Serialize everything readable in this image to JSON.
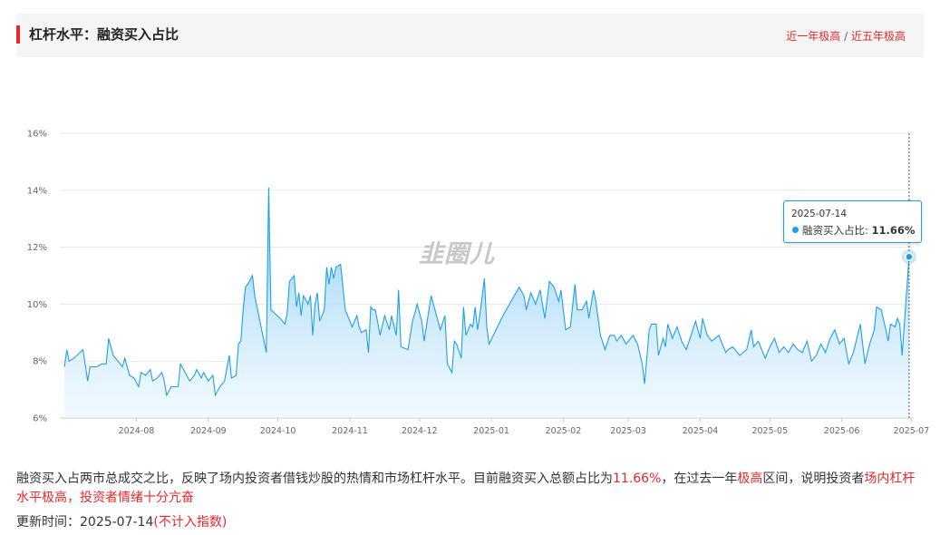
{
  "header": {
    "title": "杠杆水平：融资买入占比",
    "link_year": "近一年极高",
    "link_sep": "/",
    "link_five": "近五年极高"
  },
  "watermark": "韭圈儿",
  "tooltip": {
    "date": "2025-07-14",
    "label": "融资买入占比:",
    "value": "11.66%"
  },
  "description": {
    "p1": "融资买入占两市总成交之比，反映了场内投资者借钱炒股的热情和市场杠杆水平。目前融资买入总额占比为",
    "v1": "11.66%",
    "p2": "，在过去一年",
    "v2": "极高",
    "p3": "区间，说明投资者",
    "v3": "场内杠杆水平极高，投资者情绪十分亢奋"
  },
  "update": {
    "label": "更新时间：2025-07-14",
    "note": "(不计入指数)"
  },
  "colors": {
    "line": "#1ea0e8",
    "area_top": "#8fd0f5",
    "accent": "#e8282b"
  },
  "chart_data": {
    "type": "area",
    "series": [
      {
        "name": "融资买入占比",
        "points": [
          [
            "2024-07-15",
            7.8
          ],
          [
            "2024-07-16",
            8.4
          ],
          [
            "2024-07-17",
            8.0
          ],
          [
            "2024-07-19",
            8.1
          ],
          [
            "2024-07-23",
            8.4
          ],
          [
            "2024-07-25",
            7.3
          ],
          [
            "2024-07-26",
            7.8
          ],
          [
            "2024-07-29",
            7.8
          ],
          [
            "2024-07-31",
            7.9
          ],
          [
            "2024-08-02",
            7.9
          ],
          [
            "2024-08-03",
            8.8
          ],
          [
            "2024-08-05",
            8.2
          ],
          [
            "2024-08-07",
            8.0
          ],
          [
            "2024-08-09",
            7.8
          ],
          [
            "2024-08-10",
            8.1
          ],
          [
            "2024-08-12",
            7.5
          ],
          [
            "2024-08-14",
            7.4
          ],
          [
            "2024-08-16",
            7.1
          ],
          [
            "2024-08-17",
            7.6
          ],
          [
            "2024-08-19",
            7.5
          ],
          [
            "2024-08-21",
            7.7
          ],
          [
            "2024-08-22",
            7.3
          ],
          [
            "2024-08-24",
            7.4
          ],
          [
            "2024-08-26",
            7.6
          ],
          [
            "2024-08-27",
            7.3
          ],
          [
            "2024-08-28",
            6.8
          ],
          [
            "2024-08-30",
            7.1
          ],
          [
            "2024-09-02",
            7.1
          ],
          [
            "2024-09-03",
            7.9
          ],
          [
            "2024-09-05",
            7.6
          ],
          [
            "2024-09-07",
            7.3
          ],
          [
            "2024-09-09",
            7.5
          ],
          [
            "2024-09-10",
            7.7
          ],
          [
            "2024-09-12",
            7.4
          ],
          [
            "2024-09-13",
            7.6
          ],
          [
            "2024-09-15",
            7.3
          ],
          [
            "2024-09-17",
            7.5
          ],
          [
            "2024-09-18",
            6.8
          ],
          [
            "2024-09-20",
            7.1
          ],
          [
            "2024-09-22",
            7.3
          ],
          [
            "2024-09-24",
            8.2
          ],
          [
            "2024-09-25",
            7.4
          ],
          [
            "2024-09-27",
            7.5
          ],
          [
            "2024-09-28",
            8.6
          ],
          [
            "2024-09-29",
            8.7
          ],
          [
            "2024-09-30",
            9.8
          ],
          [
            "2024-10-01",
            10.6
          ],
          [
            "2024-10-02",
            10.7
          ],
          [
            "2024-10-04",
            11.0
          ],
          [
            "2024-10-05",
            10.3
          ],
          [
            "2024-10-10",
            8.3
          ],
          [
            "2024-10-11",
            14.1
          ],
          [
            "2024-10-12",
            9.8
          ],
          [
            "2024-10-16",
            9.5
          ],
          [
            "2024-10-18",
            9.3
          ],
          [
            "2024-10-19",
            9.7
          ],
          [
            "2024-10-20",
            10.8
          ],
          [
            "2024-10-22",
            11.0
          ],
          [
            "2024-10-23",
            9.9
          ],
          [
            "2024-10-24",
            10.4
          ],
          [
            "2024-10-25",
            9.6
          ],
          [
            "2024-10-26",
            10.3
          ],
          [
            "2024-10-28",
            10.0
          ],
          [
            "2024-10-29",
            10.3
          ],
          [
            "2024-10-30",
            8.9
          ],
          [
            "2024-10-31",
            10.0
          ],
          [
            "2024-11-01",
            10.4
          ],
          [
            "2024-11-02",
            9.4
          ],
          [
            "2024-11-04",
            9.8
          ],
          [
            "2024-11-05",
            11.3
          ],
          [
            "2024-11-06",
            10.7
          ],
          [
            "2024-11-07",
            11.3
          ],
          [
            "2024-11-08",
            10.9
          ],
          [
            "2024-11-09",
            11.3
          ],
          [
            "2024-11-11",
            11.4
          ],
          [
            "2024-11-13",
            9.8
          ],
          [
            "2024-11-15",
            9.4
          ],
          [
            "2024-11-16",
            9.2
          ],
          [
            "2024-11-18",
            9.6
          ],
          [
            "2024-11-19",
            9.2
          ],
          [
            "2024-11-20",
            9.0
          ],
          [
            "2024-11-22",
            9.1
          ],
          [
            "2024-11-23",
            8.3
          ],
          [
            "2024-11-24",
            9.9
          ],
          [
            "2024-11-25",
            9.8
          ],
          [
            "2024-11-26",
            9.8
          ],
          [
            "2024-11-28",
            8.9
          ],
          [
            "2024-11-30",
            9.6
          ],
          [
            "2024-12-02",
            9.1
          ],
          [
            "2024-12-03",
            9.6
          ],
          [
            "2024-12-05",
            8.9
          ],
          [
            "2024-12-06",
            10.5
          ],
          [
            "2024-12-07",
            8.5
          ],
          [
            "2024-12-10",
            8.4
          ],
          [
            "2024-12-12",
            9.4
          ],
          [
            "2024-12-14",
            10.0
          ],
          [
            "2024-12-16",
            9.4
          ],
          [
            "2024-12-17",
            8.7
          ],
          [
            "2024-12-20",
            10.3
          ],
          [
            "2024-12-24",
            9.1
          ],
          [
            "2024-12-26",
            9.6
          ],
          [
            "2024-12-27",
            7.9
          ],
          [
            "2024-12-29",
            7.6
          ],
          [
            "2024-12-30",
            8.7
          ],
          [
            "2024-12-31",
            8.6
          ],
          [
            "2025-01-02",
            8.1
          ],
          [
            "2025-01-03",
            9.9
          ],
          [
            "2025-01-04",
            8.9
          ],
          [
            "2025-01-06",
            9.3
          ],
          [
            "2025-01-07",
            9.2
          ],
          [
            "2025-01-08",
            9.9
          ],
          [
            "2025-01-09",
            9.1
          ],
          [
            "2025-01-10",
            9.6
          ],
          [
            "2025-01-12",
            10.9
          ],
          [
            "2025-01-13",
            9.2
          ],
          [
            "2025-01-14",
            8.6
          ],
          [
            "2025-01-20",
            9.6
          ],
          [
            "2025-01-27",
            10.6
          ],
          [
            "2025-01-29",
            10.3
          ],
          [
            "2025-01-30",
            9.8
          ],
          [
            "2025-02-01",
            10.4
          ],
          [
            "2025-02-03",
            10.0
          ],
          [
            "2025-02-05",
            10.5
          ],
          [
            "2025-02-07",
            9.5
          ],
          [
            "2025-02-09",
            10.8
          ],
          [
            "2025-02-11",
            10.6
          ],
          [
            "2025-02-13",
            10.1
          ],
          [
            "2025-02-14",
            10.5
          ],
          [
            "2025-02-16",
            9.1
          ],
          [
            "2025-02-18",
            9.2
          ],
          [
            "2025-02-20",
            10.7
          ],
          [
            "2025-02-21",
            9.8
          ],
          [
            "2025-02-23",
            9.8
          ],
          [
            "2025-02-25",
            10.1
          ],
          [
            "2025-02-26",
            9.5
          ],
          [
            "2025-02-28",
            10.5
          ],
          [
            "2025-03-01",
            10.1
          ],
          [
            "2025-03-03",
            8.9
          ],
          [
            "2025-03-05",
            8.4
          ],
          [
            "2025-03-07",
            8.9
          ],
          [
            "2025-03-09",
            8.9
          ],
          [
            "2025-03-10",
            8.7
          ],
          [
            "2025-03-12",
            8.9
          ],
          [
            "2025-03-14",
            8.6
          ],
          [
            "2025-03-17",
            8.9
          ],
          [
            "2025-03-19",
            8.6
          ],
          [
            "2025-03-21",
            7.9
          ],
          [
            "2025-03-22",
            7.2
          ],
          [
            "2025-03-24",
            9.1
          ],
          [
            "2025-03-25",
            9.3
          ],
          [
            "2025-03-27",
            9.3
          ],
          [
            "2025-03-28",
            8.2
          ],
          [
            "2025-03-30",
            8.8
          ],
          [
            "2025-03-31",
            8.5
          ],
          [
            "2025-04-01",
            9.3
          ],
          [
            "2025-04-03",
            8.8
          ],
          [
            "2025-04-05",
            9.2
          ],
          [
            "2025-04-07",
            8.7
          ],
          [
            "2025-04-09",
            8.4
          ],
          [
            "2025-04-11",
            8.9
          ],
          [
            "2025-04-13",
            9.4
          ],
          [
            "2025-04-15",
            8.8
          ],
          [
            "2025-04-16",
            9.5
          ],
          [
            "2025-04-18",
            8.9
          ],
          [
            "2025-04-20",
            8.7
          ],
          [
            "2025-04-23",
            8.9
          ],
          [
            "2025-04-26",
            8.3
          ],
          [
            "2025-04-27",
            8.4
          ],
          [
            "2025-04-29",
            8.5
          ],
          [
            "2025-05-02",
            8.2
          ],
          [
            "2025-05-05",
            8.4
          ],
          [
            "2025-05-07",
            9.1
          ],
          [
            "2025-05-08",
            8.5
          ],
          [
            "2025-05-10",
            8.7
          ],
          [
            "2025-05-13",
            8.1
          ],
          [
            "2025-05-15",
            8.5
          ],
          [
            "2025-05-17",
            8.8
          ],
          [
            "2025-05-19",
            8.3
          ],
          [
            "2025-05-21",
            8.5
          ],
          [
            "2025-05-23",
            8.3
          ],
          [
            "2025-05-25",
            8.6
          ],
          [
            "2025-05-27",
            8.4
          ],
          [
            "2025-05-29",
            8.3
          ],
          [
            "2025-05-31",
            8.7
          ],
          [
            "2025-06-02",
            8.0
          ],
          [
            "2025-06-04",
            8.2
          ],
          [
            "2025-06-06",
            8.6
          ],
          [
            "2025-06-08",
            8.3
          ],
          [
            "2025-06-10",
            8.8
          ],
          [
            "2025-06-12",
            9.1
          ],
          [
            "2025-06-14",
            8.6
          ],
          [
            "2025-06-16",
            8.8
          ],
          [
            "2025-06-18",
            7.9
          ],
          [
            "2025-06-20",
            8.3
          ],
          [
            "2025-06-23",
            9.3
          ],
          [
            "2025-06-25",
            7.9
          ],
          [
            "2025-06-27",
            8.6
          ],
          [
            "2025-06-29",
            9.1
          ],
          [
            "2025-06-30",
            9.9
          ],
          [
            "2025-07-02",
            9.8
          ],
          [
            "2025-07-04",
            9.1
          ],
          [
            "2025-07-05",
            8.7
          ],
          [
            "2025-07-06",
            9.3
          ],
          [
            "2025-07-08",
            9.2
          ],
          [
            "2025-07-09",
            9.5
          ],
          [
            "2025-07-10",
            9.3
          ],
          [
            "2025-07-11",
            8.2
          ],
          [
            "2025-07-14",
            11.66
          ]
        ]
      }
    ],
    "x_ticks": [
      "2024-08",
      "2024-09",
      "2024-10",
      "2024-11",
      "2024-12",
      "2025-01",
      "2025-02",
      "2025-03",
      "2025-04",
      "2025-05",
      "2025-06",
      "2025-07"
    ],
    "y_ticks": [
      "6%",
      "8%",
      "10%",
      "12%",
      "14%",
      "16%"
    ],
    "ylim": [
      6,
      16
    ],
    "xlim": [
      "2024-07-13",
      "2025-07-16"
    ],
    "grid": true,
    "highlight_date": "2025-07-14"
  }
}
